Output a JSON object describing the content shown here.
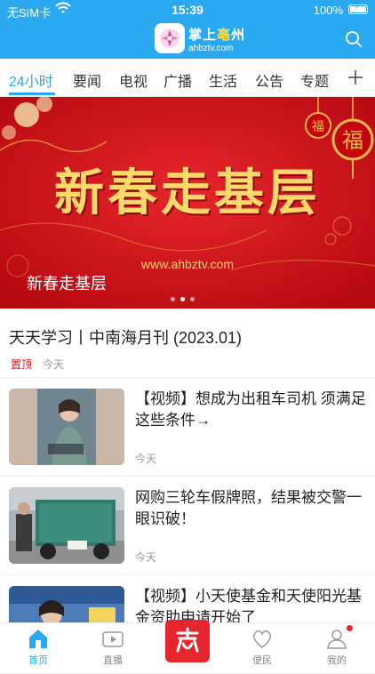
{
  "status": {
    "carrier": "无SIM卡",
    "time": "15:39",
    "battery": "100%"
  },
  "header": {
    "logo_cn_a": "掌上",
    "logo_cn_b": "亳",
    "logo_cn_c": "州",
    "logo_en": "ahbztv.com"
  },
  "tabs": [
    "24小时",
    "要闻",
    "电视",
    "广播",
    "生活",
    "公告",
    "专题"
  ],
  "banner": {
    "title": "新春走基层",
    "url": "www.ahbztv.com",
    "caption": "新春走基层",
    "slides": 3,
    "active_slide": 2
  },
  "pinned": {
    "title": "天天学习丨中南海月刊 (2023.01)",
    "tag": "置顶",
    "time": "今天"
  },
  "news": [
    {
      "title": "【视频】想成为出租车司机 须满足这些条件→",
      "time": "今天"
    },
    {
      "title": "网购三轮车假牌照，结果被交警一眼识破！",
      "time": "今天"
    },
    {
      "title": "【视频】小天使基金和天使阳光基金资助申请开始了",
      "time": ""
    }
  ],
  "bottom_nav": [
    "首页",
    "直播",
    "便民",
    "我的"
  ],
  "colors": {
    "accent": "#2aa9f0",
    "red": "#d4141b"
  }
}
